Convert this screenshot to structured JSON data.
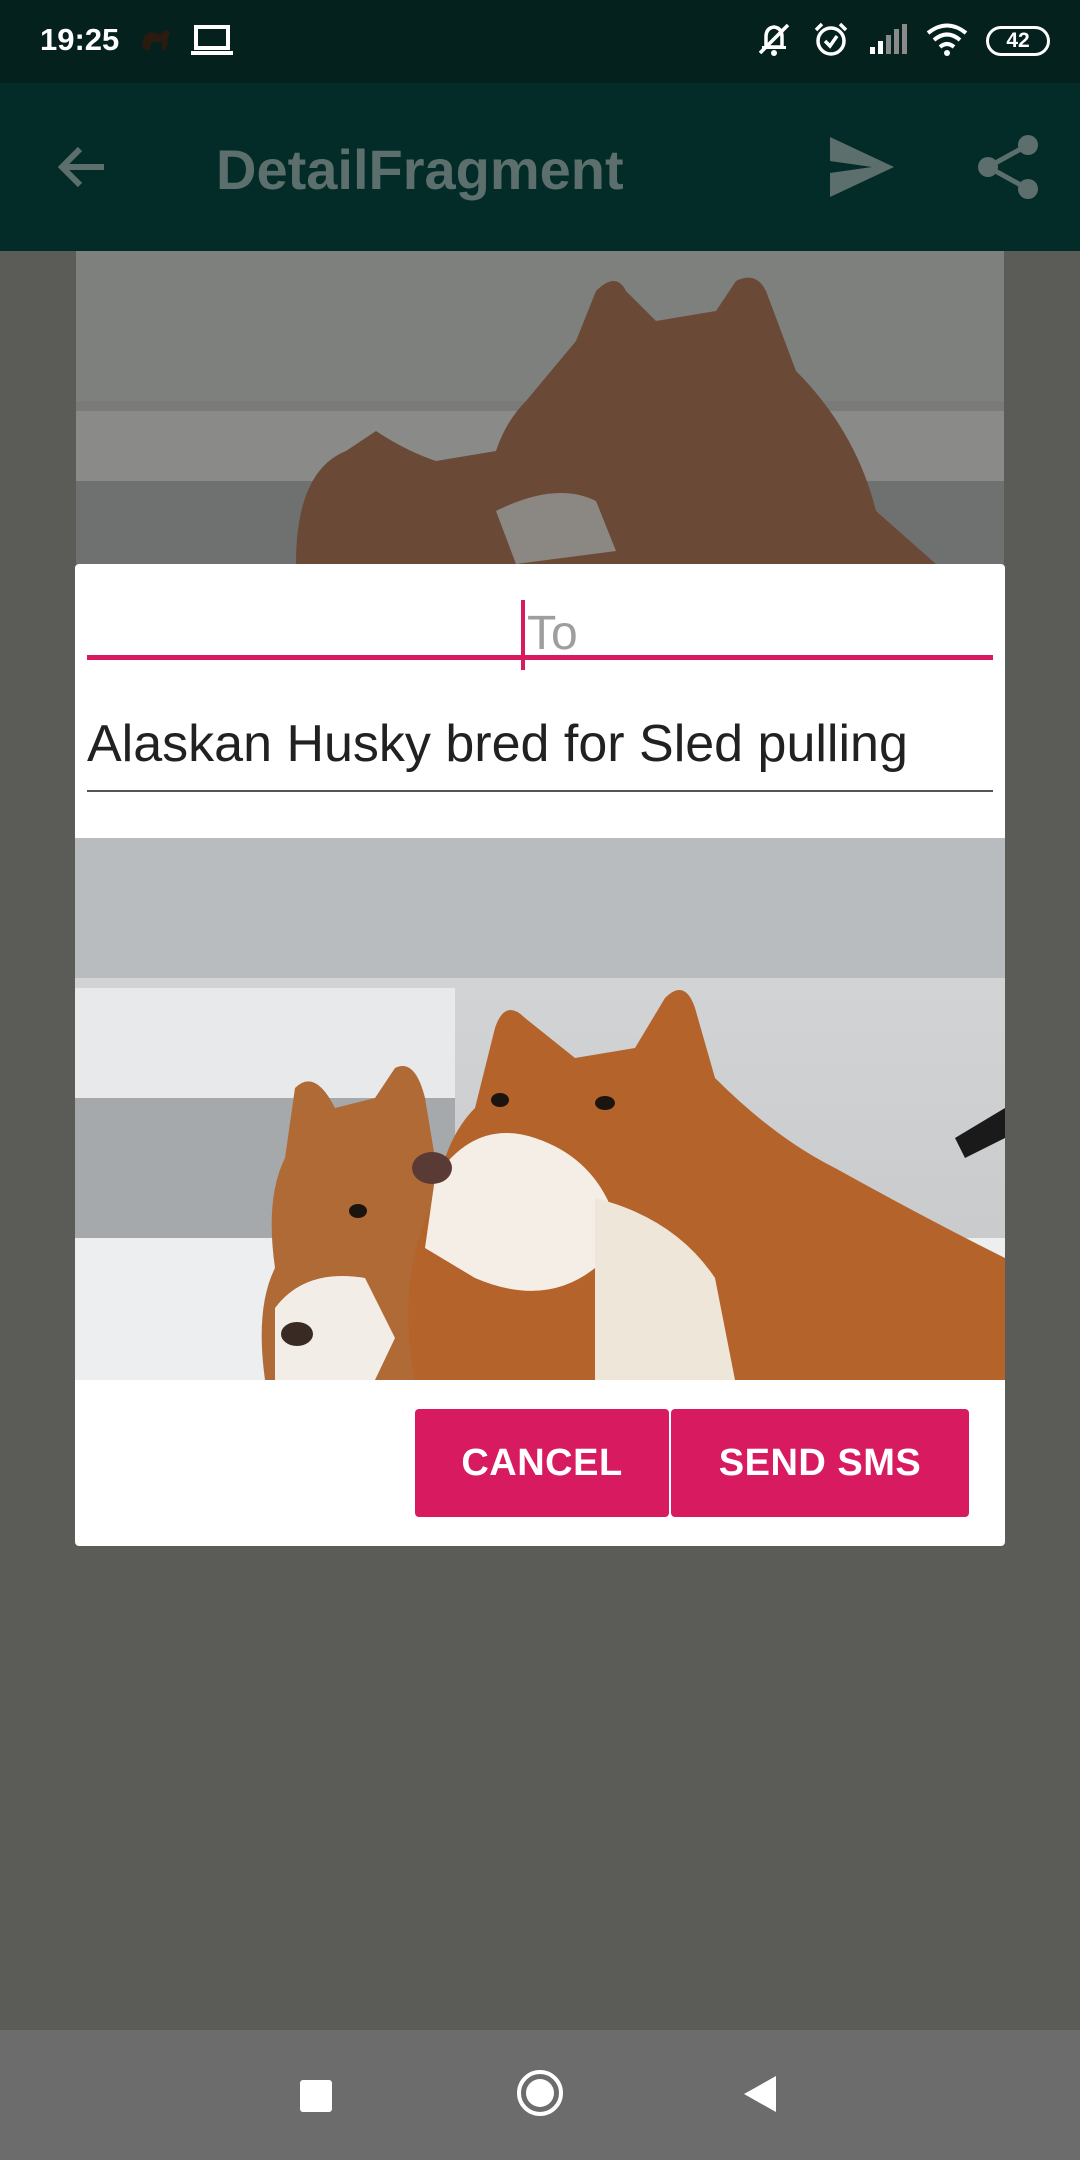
{
  "status_bar": {
    "time": "19:25",
    "battery": "42",
    "icons": [
      "dog-icon",
      "laptop-icon",
      "notifications-muted-icon",
      "alarm-icon",
      "signal-icon",
      "wifi-icon",
      "battery-icon"
    ]
  },
  "app_bar": {
    "title": "DetailFragment",
    "back_icon": "arrow-left-icon",
    "actions": [
      "send-icon",
      "share-icon"
    ]
  },
  "dialog": {
    "to_placeholder": "To",
    "message": "Alaskan Husky bred for Sled pulling",
    "cancel_label": "CANCEL",
    "send_label": "SEND SMS"
  },
  "nav_bar": {
    "buttons": [
      "recents-icon",
      "home-icon",
      "back-icon"
    ]
  },
  "colors": {
    "accent": "#d81b60",
    "app_bar": "#032c28",
    "status_bar": "#05211d",
    "scrim": "#5b5c58"
  }
}
